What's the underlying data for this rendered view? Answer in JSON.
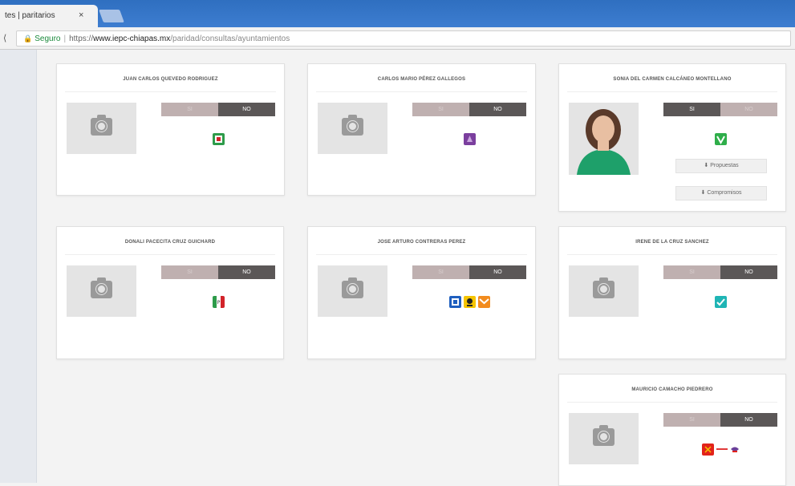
{
  "browser": {
    "tab_title": "tes | paritarios",
    "tab_close": "×",
    "back_glyph": "⟨",
    "secure_label": "Seguro",
    "url_scheme": "https://",
    "url_host": "www.iepc-chiapas.mx",
    "url_path": "/paridad/consultas/ayuntamientos"
  },
  "toggle_labels": {
    "si": "SI",
    "no": "NO"
  },
  "buttons": {
    "propuestas": "Propuestas",
    "compromisos": "Compromisos",
    "download_glyph": "⬇"
  },
  "candidates": [
    {
      "name": "JUAN CARLOS QUEVEDO RODRIGUEZ",
      "selected": "NO",
      "photo": "camera-placeholder",
      "logos": [
        "pvem"
      ]
    },
    {
      "name": "CARLOS MARIO PÉREZ GALLEGOS",
      "selected": "NO",
      "photo": "camera-placeholder",
      "logos": [
        "morena-violet"
      ]
    },
    {
      "name": "SONIA DEL CARMEN CALCÁNEO MONTELLANO",
      "selected": "SI",
      "photo": "candidate-portrait",
      "logos": [
        "green-party"
      ]
    },
    {
      "name": "DONALI PACECITA CRUZ GUICHARD",
      "selected": "NO",
      "photo": "camera-placeholder",
      "logos": [
        "pri"
      ]
    },
    {
      "name": "JOSE ARTURO CONTRERAS PEREZ",
      "selected": "NO",
      "photo": "camera-placeholder",
      "logos": [
        "pan",
        "prd",
        "mc"
      ]
    },
    {
      "name": "IRENE DE LA CRUZ SANCHEZ",
      "selected": "NO",
      "photo": "camera-placeholder",
      "logos": [
        "nueva-alianza"
      ]
    },
    {
      "name": "MAURICIO CAMACHO PIEDRERO",
      "selected": "NO",
      "photo": "camera-placeholder",
      "logos": [
        "pt",
        "pes"
      ]
    }
  ],
  "colors": {
    "toggle_dark": "#5b5757",
    "toggle_light": "#bfb0b0",
    "pvem": "#2e9b4a",
    "morena_violet": "#7b3f9e",
    "green_party": "#2fae4a",
    "pri_red": "#d2232a",
    "pan_blue": "#1f5fbf",
    "prd_yellow": "#f5c400",
    "mc_orange": "#f28c1e",
    "nueva_alianza": "#1fb5b5",
    "pt_red": "#e2231a",
    "pes_purple": "#6a3e98"
  }
}
